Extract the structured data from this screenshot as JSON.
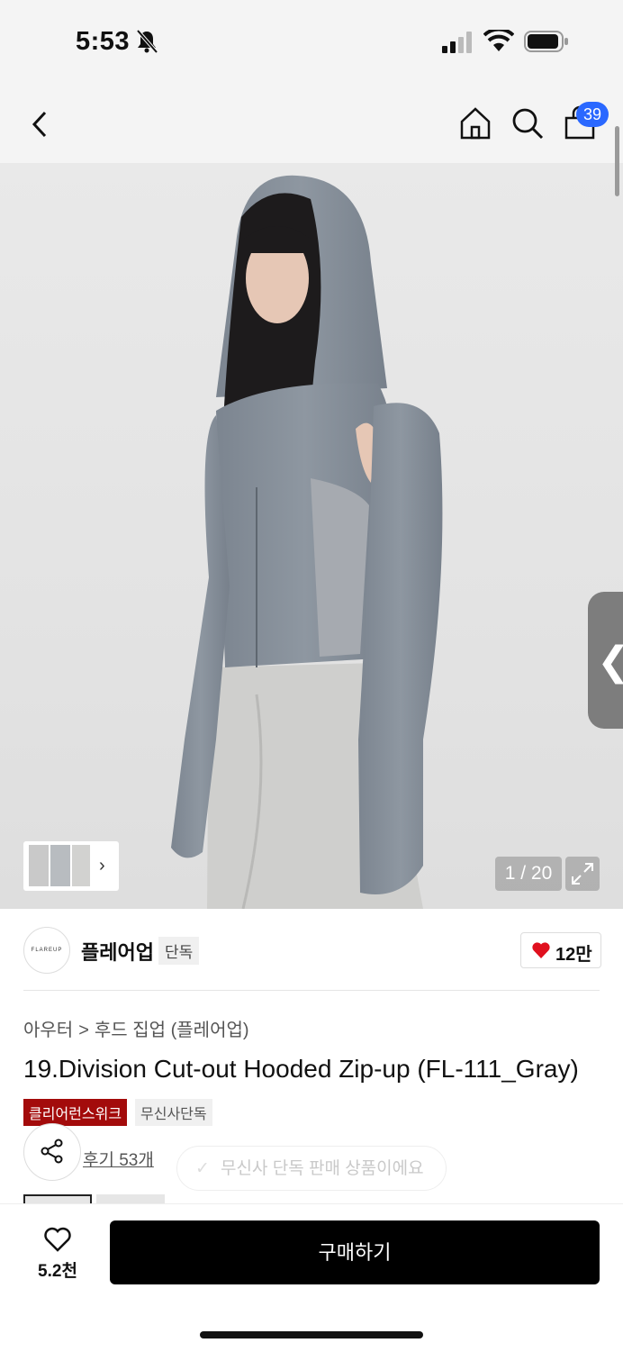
{
  "status_bar": {
    "time": "5:53"
  },
  "nav": {
    "cart_count": "39"
  },
  "gallery": {
    "counter": "1 / 20"
  },
  "brand": {
    "logo_text": "FLAREUP",
    "name": "플레어업",
    "tag": "단독",
    "likes": "12만"
  },
  "product": {
    "category": [
      "아우터",
      "후드 집업 (플레어업)"
    ],
    "category_separator": ">",
    "title": "19.Division Cut-out Hooded Zip-up (FL-111_Gray)",
    "badges": [
      "클리어런스위크",
      "무신사단독"
    ],
    "reviews": "후기 53개",
    "toast": "무신사 단독 판매 상품이에요"
  },
  "bottom_bar": {
    "wish_count": "5.2천",
    "buy_label": "구매하기"
  },
  "colors": {
    "accent_blue": "#2a68ff",
    "badge_red": "#a30b0b",
    "heart_red": "#e0101e",
    "buy_bg": "#000000"
  }
}
